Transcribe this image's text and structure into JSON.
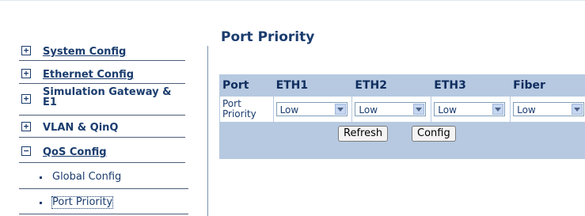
{
  "sidebar": {
    "items": [
      {
        "toggle": "+",
        "label": "System Config"
      },
      {
        "toggle": "+",
        "label": "Ethernet Config"
      },
      {
        "toggle": "+",
        "label": "Simulation Gateway & E1"
      },
      {
        "toggle": "+",
        "label": "VLAN & QinQ"
      },
      {
        "toggle": "−",
        "label": "QoS Config"
      }
    ],
    "subitems": [
      {
        "label": "Global Config"
      },
      {
        "label": "Port Priority"
      }
    ]
  },
  "main": {
    "title": "Port Priority",
    "table": {
      "headers": [
        "Port",
        "ETH1",
        "ETH2",
        "ETH3",
        "Fiber"
      ],
      "row_label": "Port Priority",
      "values": [
        "Low",
        "Low",
        "Low",
        "Low"
      ]
    },
    "buttons": {
      "refresh": "Refresh",
      "config": "Config"
    }
  }
}
